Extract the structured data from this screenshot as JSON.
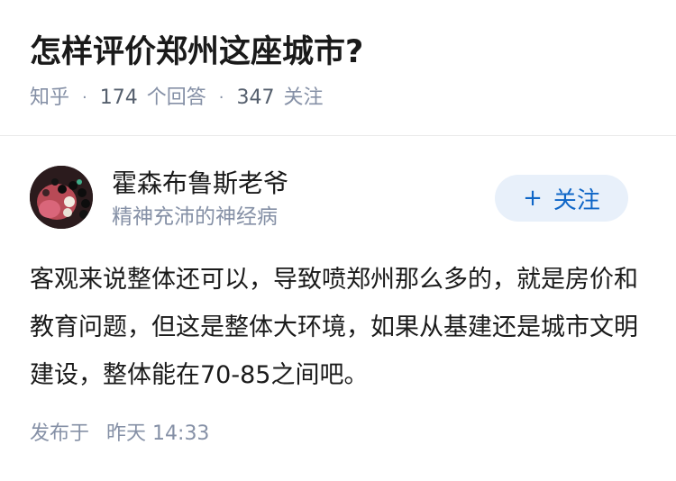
{
  "question": {
    "title": "怎样评价郑州这座城市?",
    "source": "知乎",
    "answers_count": "174",
    "answers_label": "个回答",
    "followers_count": "347",
    "followers_label": "关注"
  },
  "author": {
    "name": "霍森布鲁斯老爷",
    "headline": "精神充沛的神经病",
    "avatar_icon": "avatar-photo-icon"
  },
  "follow_button": {
    "plus": "+",
    "label": "关注",
    "bg_color": "#e8f0fa",
    "text_color": "#0f66c7"
  },
  "answer": {
    "content": "客观来说整体还可以，导致喷郑州那么多的，就是房价和教育问题，但这是整体大环境，如果从基建还是城市文明建设，整体能在70-85之间吧。",
    "published_label": "发布于",
    "published_day": "昨天",
    "published_time": "14:33"
  }
}
